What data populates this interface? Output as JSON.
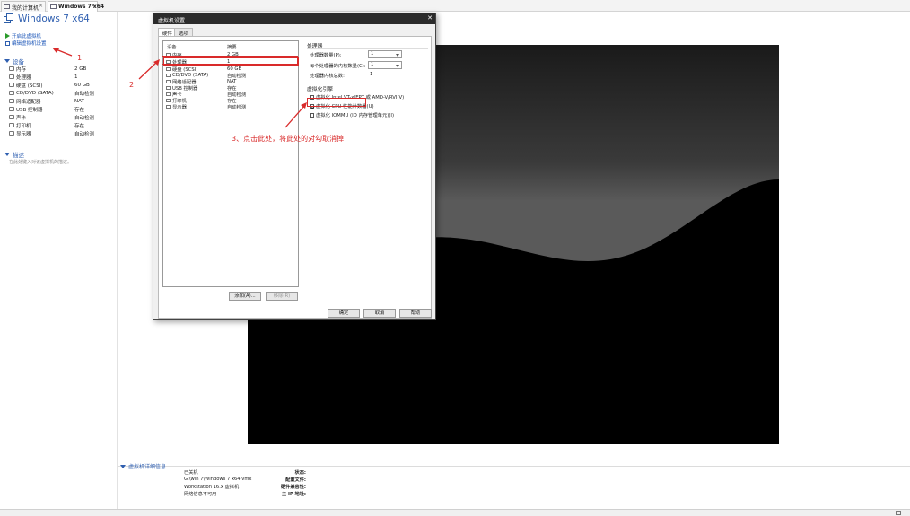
{
  "tabs": [
    {
      "label": "我的计算机"
    },
    {
      "label": "Windows 7 x64"
    }
  ],
  "vm_title": "Windows 7 x64",
  "actions": [
    {
      "label": "开启此虚拟机",
      "icon": "play-icon"
    },
    {
      "label": "编辑虚拟机设置",
      "icon": "edit-icon"
    }
  ],
  "devices_header": "设备",
  "devices": [
    {
      "name": "内存",
      "value": "2 GB",
      "icon": "memory-icon"
    },
    {
      "name": "处理器",
      "value": "1",
      "icon": "cpu-icon"
    },
    {
      "name": "硬盘 (SCSI)",
      "value": "60 GB",
      "icon": "disk-icon"
    },
    {
      "name": "CD/DVD (SATA)",
      "value": "自动检测",
      "icon": "cd-icon"
    },
    {
      "name": "网络适配器",
      "value": "NAT",
      "icon": "network-icon"
    },
    {
      "name": "USB 控制器",
      "value": "存在",
      "icon": "usb-icon"
    },
    {
      "name": "声卡",
      "value": "自动检测",
      "icon": "sound-icon"
    },
    {
      "name": "打印机",
      "value": "存在",
      "icon": "printer-icon"
    },
    {
      "name": "显示器",
      "value": "自动检测",
      "icon": "display-icon"
    }
  ],
  "description_header": "描述",
  "description_placeholder": "在此处键入对该虚拟机的描述。",
  "details": {
    "title": "虚拟机详细信息",
    "rows": [
      {
        "key": "状态:",
        "value": "已关机"
      },
      {
        "key": "配置文件:",
        "value": "G:\\win 7\\Windows 7 x64.vmx"
      },
      {
        "key": "硬件兼容性:",
        "value": "Workstation 16.x 虚拟机"
      },
      {
        "key": "主 IP 地址:",
        "value": "网络信息不可用"
      }
    ]
  },
  "dialog": {
    "title": "虚拟机设置",
    "close": "✕",
    "tabs": [
      "硬件",
      "选项"
    ],
    "list_headers": {
      "device": "设备",
      "summary": "摘要"
    },
    "list": [
      {
        "name": "内存",
        "summary": "2 GB",
        "icon": "memory-icon"
      },
      {
        "name": "处理器",
        "summary": "1",
        "icon": "cpu-icon"
      },
      {
        "name": "硬盘 (SCSI)",
        "summary": "60 GB",
        "icon": "disk-icon"
      },
      {
        "name": "CD/DVD (SATA)",
        "summary": "自动检测",
        "icon": "cd-icon"
      },
      {
        "name": "网络适配器",
        "summary": "NAT",
        "icon": "network-icon"
      },
      {
        "name": "USB 控制器",
        "summary": "存在",
        "icon": "usb-icon"
      },
      {
        "name": "声卡",
        "summary": "自动检测",
        "icon": "sound-icon"
      },
      {
        "name": "打印机",
        "summary": "存在",
        "icon": "printer-icon"
      },
      {
        "name": "显示器",
        "summary": "自动检测",
        "icon": "display-icon"
      }
    ],
    "add_button": "添加(A)...",
    "remove_button": "移除(R)",
    "processors_group": "处理器",
    "proc_count_label": "处理器数量(P):",
    "proc_count_value": "1",
    "cores_label": "每个处理器的内核数量(C):",
    "cores_value": "1",
    "total_cores_label": "处理器内核总数:",
    "total_cores_value": "1",
    "virt_group": "虚拟化引擎",
    "virt_options": [
      {
        "label": "虚拟化 Intel VT-x/EPT 或 AMD-V/RVI(V)",
        "checked": false
      },
      {
        "label": "虚拟化 CPU 性能计数器(U)",
        "checked": true
      },
      {
        "label": "虚拟化 IOMMU (IO 内存管理单元)(I)",
        "checked": false
      }
    ],
    "ok": "确定",
    "cancel": "取消",
    "help": "帮助"
  },
  "annotations": {
    "a1": "1",
    "a2": "2",
    "a3": "3、点击此处，将此处的对勾取消掉"
  }
}
